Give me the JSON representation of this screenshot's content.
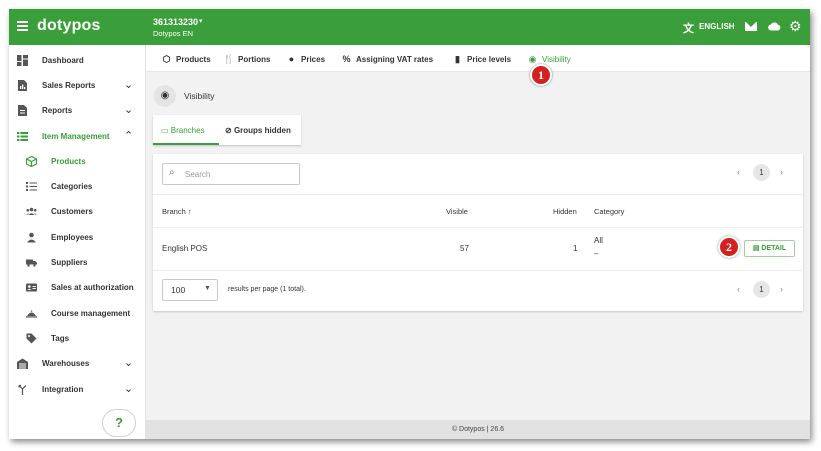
{
  "app": {
    "logo": "dotypos",
    "account_id": "361313230",
    "account_name": "Dotypos EN",
    "language": "ENGLISH"
  },
  "sidebar": {
    "items": [
      {
        "label": "Dashboard",
        "icon": "dashboard-icon"
      },
      {
        "label": "Sales Reports",
        "icon": "sales-report-icon"
      },
      {
        "label": "Reports",
        "icon": "document-icon"
      },
      {
        "label": "Item Management",
        "icon": "list-icon"
      },
      {
        "label": "Products",
        "icon": "cube-icon"
      },
      {
        "label": "Categories",
        "icon": "categories-icon"
      },
      {
        "label": "Customers",
        "icon": "people-icon"
      },
      {
        "label": "Employees",
        "icon": "person-icon"
      },
      {
        "label": "Suppliers",
        "icon": "truck-icon"
      },
      {
        "label": "Sales at authorization",
        "icon": "id-card-icon"
      },
      {
        "label": "Course management",
        "icon": "cloche-icon"
      },
      {
        "label": "Tags",
        "icon": "tag-icon"
      },
      {
        "label": "Warehouses",
        "icon": "warehouse-icon"
      },
      {
        "label": "Integration",
        "icon": "merge-icon"
      }
    ],
    "help_label": "?"
  },
  "tabs": [
    {
      "label": "Products",
      "icon": "cube-icon"
    },
    {
      "label": "Portions",
      "icon": "cutlery-icon"
    },
    {
      "label": "Prices",
      "icon": "price-icon"
    },
    {
      "label": "Assigning VAT rates",
      "icon": "percent-icon"
    },
    {
      "label": "Price levels",
      "icon": "bar-chart-icon"
    },
    {
      "label": "Visibility",
      "icon": "eye-icon"
    }
  ],
  "section": {
    "title": "Visibility"
  },
  "subtabs": [
    {
      "label": "Branches",
      "icon": "monitor-icon"
    },
    {
      "label": "Groups hidden",
      "icon": "eye-off-icon"
    }
  ],
  "search": {
    "placeholder": "Search"
  },
  "pagination": {
    "current_page": "1"
  },
  "table": {
    "headers": {
      "branch": "Branch",
      "visible": "Visible",
      "hidden": "Hidden",
      "category": "Category"
    },
    "rows": [
      {
        "branch": "English POS",
        "visible": "57",
        "hidden": "1",
        "category_line1": "All",
        "category_line2": "–",
        "action": "DETAIL"
      }
    ]
  },
  "footer": {
    "per_page": "100",
    "results_text": "results per page (1 total).",
    "copyright": "© Dotypos  | 26.6"
  },
  "annotations": {
    "badge1": "1",
    "badge2": "2"
  },
  "colors": {
    "brand_green": "#3a9e3a",
    "annotation_red": "#d32020"
  }
}
